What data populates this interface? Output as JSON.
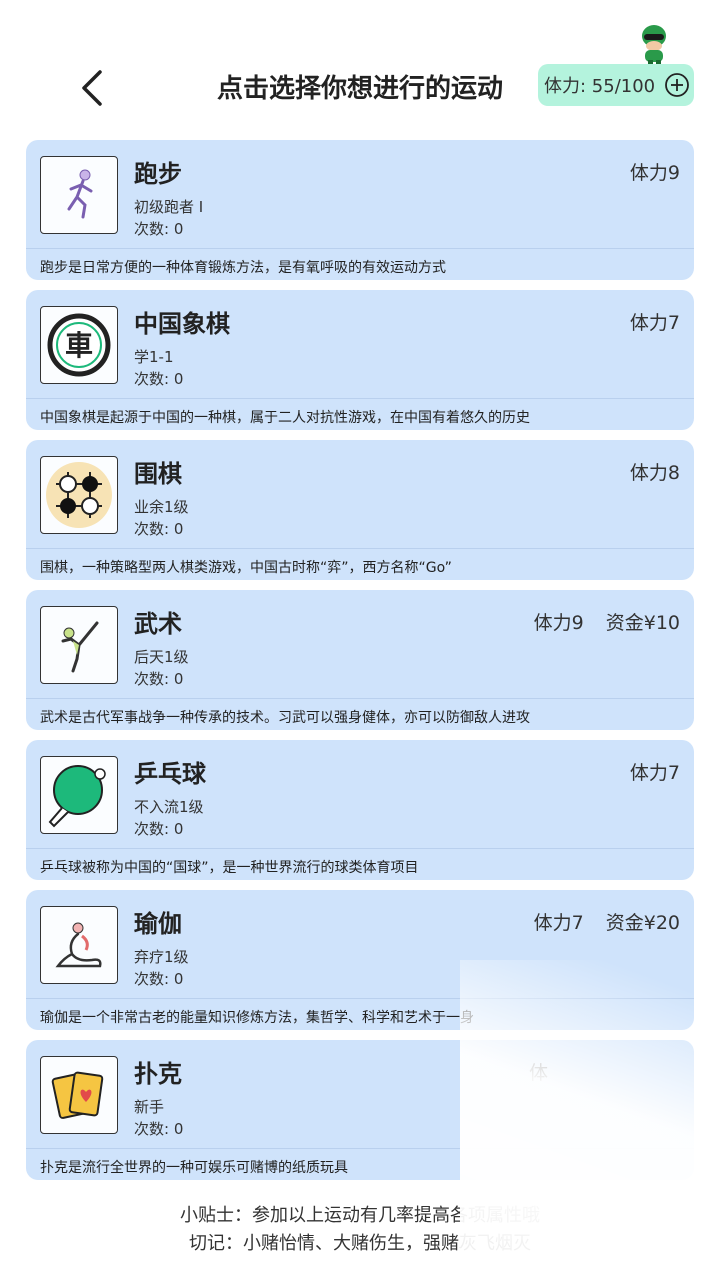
{
  "header": {
    "title": "点击选择你想进行的运动",
    "stamina_label": "体力: 55/100"
  },
  "activities": [
    {
      "name": "跑步",
      "level": "初级跑者 I",
      "count": "次数: 0",
      "cost": "体力9",
      "money": "",
      "desc": "跑步是日常方便的一种体育锻炼方法，是有氧呼吸的有效运动方式",
      "icon": "running-icon"
    },
    {
      "name": "中国象棋",
      "level": "学1-1",
      "count": "次数: 0",
      "cost": "体力7",
      "money": "",
      "desc": "中国象棋是起源于中国的一种棋，属于二人对抗性游戏，在中国有着悠久的历史",
      "icon": "chinese-chess-icon"
    },
    {
      "name": "围棋",
      "level": "业余1级",
      "count": "次数: 0",
      "cost": "体力8",
      "money": "",
      "desc": "围棋，一种策略型两人棋类游戏，中国古时称“弈”，西方名称“Go”",
      "icon": "go-icon"
    },
    {
      "name": "武术",
      "level": "后天1级",
      "count": "次数: 0",
      "cost": "体力9",
      "money": "资金¥10",
      "desc": "武术是古代军事战争一种传承的技术。习武可以强身健体，亦可以防御敌人进攻",
      "icon": "martial-arts-icon"
    },
    {
      "name": "乒乓球",
      "level": "不入流1级",
      "count": "次数: 0",
      "cost": "体力7",
      "money": "",
      "desc": "乒乓球被称为中国的“国球”，是一种世界流行的球类体育项目",
      "icon": "ping-pong-icon"
    },
    {
      "name": "瑜伽",
      "level": "弃疗1级",
      "count": "次数: 0",
      "cost": "体力7",
      "money": "资金¥20",
      "desc": "瑜伽是一个非常古老的能量知识修炼方法，集哲学、科学和艺术于一身",
      "icon": "yoga-icon"
    },
    {
      "name": "扑克",
      "level": "新手",
      "count": "次数: 0",
      "cost": "体",
      "money": "",
      "desc": "扑克是流行全世界的一种可娱乐可赌博的纸质玩具",
      "icon": "poker-icon"
    }
  ],
  "tips": {
    "line1": "小贴士：参加以上运动有几率提高各项属性哦",
    "line2": "切记：小赌怡情、大赌伤生，强赌灰飞烟灭"
  },
  "colors": {
    "card_bg": "#cfe3fb",
    "stamina_bg": "#b4f3dd",
    "accent_green": "#1db97b"
  }
}
